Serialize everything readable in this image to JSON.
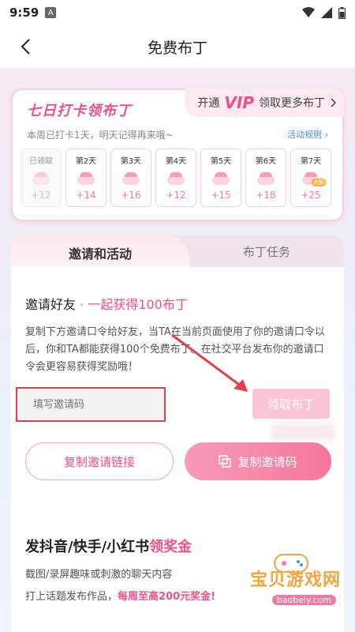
{
  "status_bar": {
    "time": "9:59",
    "a_icon": "A"
  },
  "nav": {
    "title": "免费布丁"
  },
  "checkin": {
    "title": "七日打卡领布丁",
    "vip_prefix": "开通",
    "vip_label": "VIP",
    "vip_suffix": "领取更多布丁",
    "subtitle": "本周已打卡1天，明天记得再来哦~",
    "rules_link": "活动规则",
    "days": [
      {
        "label": "已领取",
        "points": "+12",
        "claimed": true
      },
      {
        "label": "第2天",
        "points": "+14"
      },
      {
        "label": "第3天",
        "points": "+16"
      },
      {
        "label": "第4天",
        "points": "+12"
      },
      {
        "label": "第5天",
        "points": "+15"
      },
      {
        "label": "第6天",
        "points": "+18"
      },
      {
        "label": "第7天",
        "points": "+25",
        "badge": "大额"
      }
    ]
  },
  "tabs": {
    "active": "邀请和活动",
    "inactive": "布丁任务"
  },
  "invite": {
    "title": "邀请好友",
    "title_highlight": "· 一起获得100布丁",
    "description": "复制下方邀请口令给好友，当TA在当前页面使用了你的邀请口令以后，你和TA都能获得100个免费布丁。在社交平台发布你的邀请口令会更容易获得奖励哦！",
    "input_placeholder": "填写邀请码",
    "claim_button": "领取布丁",
    "copy_link_button": "复制邀请链接",
    "copy_code_button": "复制邀请码"
  },
  "promo": {
    "title": "发抖音/快手/小红书",
    "title_highlight": "领奖金",
    "line1": "截图/录屏趣味或刺激的聊天内容",
    "line2": "打上话题发布作品，",
    "line2_bonus": "每周至高200元奖金!"
  },
  "watermark": {
    "text": "宝贝游戏网",
    "url": "baobeiy.com"
  },
  "colors": {
    "accent": "#f0508a",
    "claim_disabled": "#fbc5d6",
    "annotation_red": "#e04048"
  }
}
